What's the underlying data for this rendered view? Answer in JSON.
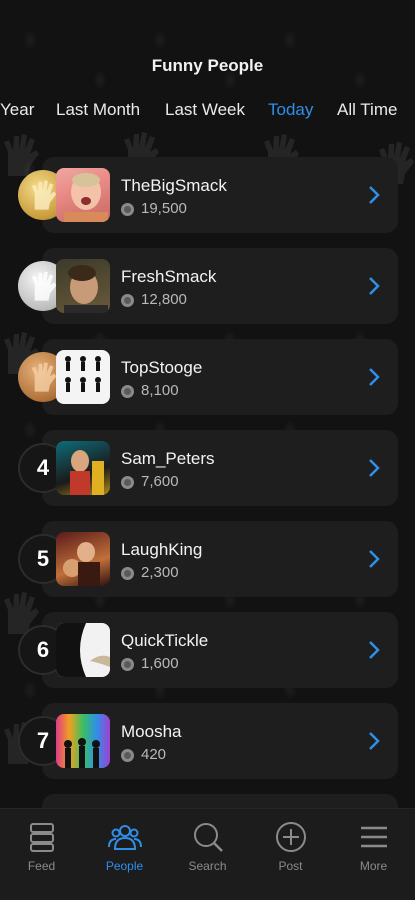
{
  "page_title": "Funny People",
  "tabs": [
    {
      "label": "Year",
      "active": false
    },
    {
      "label": "Last Month",
      "active": false
    },
    {
      "label": "Last Week",
      "active": false
    },
    {
      "label": "Today",
      "active": true
    },
    {
      "label": "All Time",
      "active": false
    }
  ],
  "leaderboard": [
    {
      "rank": "1",
      "medal": "gold",
      "name": "TheBigSmack",
      "score": "19,500"
    },
    {
      "rank": "2",
      "medal": "silver",
      "name": "FreshSmack",
      "score": "12,800"
    },
    {
      "rank": "3",
      "medal": "bronze",
      "name": "TopStooge",
      "score": "8,100"
    },
    {
      "rank": "4",
      "medal": "",
      "name": "Sam_Peters",
      "score": "7,600"
    },
    {
      "rank": "5",
      "medal": "",
      "name": "LaughKing",
      "score": "2,300"
    },
    {
      "rank": "6",
      "medal": "",
      "name": "QuickTickle",
      "score": "1,600"
    },
    {
      "rank": "7",
      "medal": "",
      "name": "Moosha",
      "score": "420"
    }
  ],
  "bottom_nav": [
    {
      "label": "Feed",
      "icon": "feed-icon",
      "active": false
    },
    {
      "label": "People",
      "icon": "people-icon",
      "active": true
    },
    {
      "label": "Search",
      "icon": "search-icon",
      "active": false
    },
    {
      "label": "Post",
      "icon": "post-icon",
      "active": false
    },
    {
      "label": "More",
      "icon": "menu-icon",
      "active": false
    }
  ],
  "colors": {
    "accent": "#2f8fe8",
    "card": "#1e1e1e",
    "background": "#121212"
  }
}
